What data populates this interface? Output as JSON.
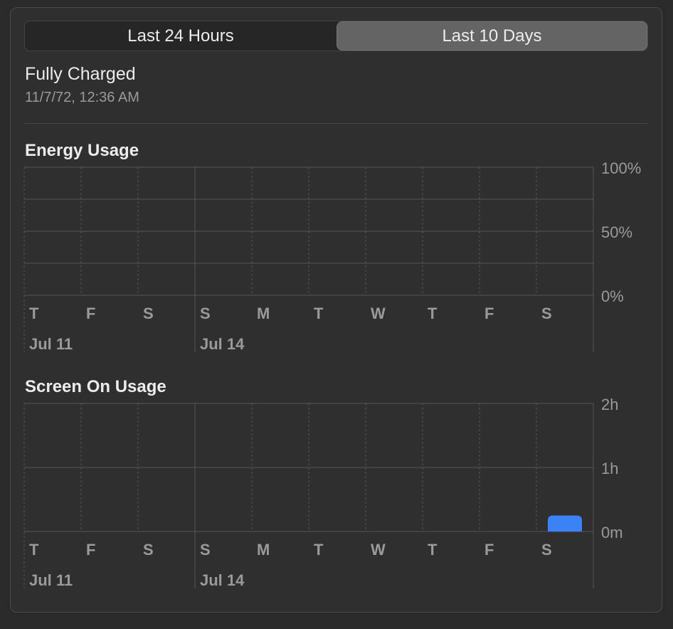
{
  "segmented": {
    "left_label": "Last 24 Hours",
    "right_label": "Last 10 Days",
    "selected": "Last 10 Days"
  },
  "status": {
    "title": "Fully Charged",
    "time": "11/7/72, 12:36 AM"
  },
  "colors": {
    "accent": "#3b82f6",
    "grid": "#555555",
    "text": "#ececec",
    "muted": "#9a9a9a"
  },
  "chart_data": [
    {
      "type": "bar",
      "title": "Energy Usage",
      "categories": [
        "T",
        "F",
        "S",
        "S",
        "M",
        "T",
        "W",
        "T",
        "F",
        "S"
      ],
      "date_labels": [
        {
          "index": 0,
          "label": "Jul 11"
        },
        {
          "index": 3,
          "label": "Jul 14"
        }
      ],
      "y_ticks": [
        "100%",
        "50%",
        "0%"
      ],
      "ylim": [
        0,
        100
      ],
      "values": [
        0,
        0,
        0,
        0,
        0,
        0,
        0,
        0,
        0,
        0
      ],
      "grid": true
    },
    {
      "type": "bar",
      "title": "Screen On Usage",
      "categories": [
        "T",
        "F",
        "S",
        "S",
        "M",
        "T",
        "W",
        "T",
        "F",
        "S"
      ],
      "date_labels": [
        {
          "index": 0,
          "label": "Jul 11"
        },
        {
          "index": 3,
          "label": "Jul 14"
        }
      ],
      "y_ticks": [
        "2h",
        "1h",
        "0m"
      ],
      "ylim": [
        0,
        120
      ],
      "unit": "minutes",
      "values": [
        0,
        0,
        0,
        0,
        0,
        0,
        0,
        0,
        0,
        15
      ],
      "grid": true
    }
  ]
}
